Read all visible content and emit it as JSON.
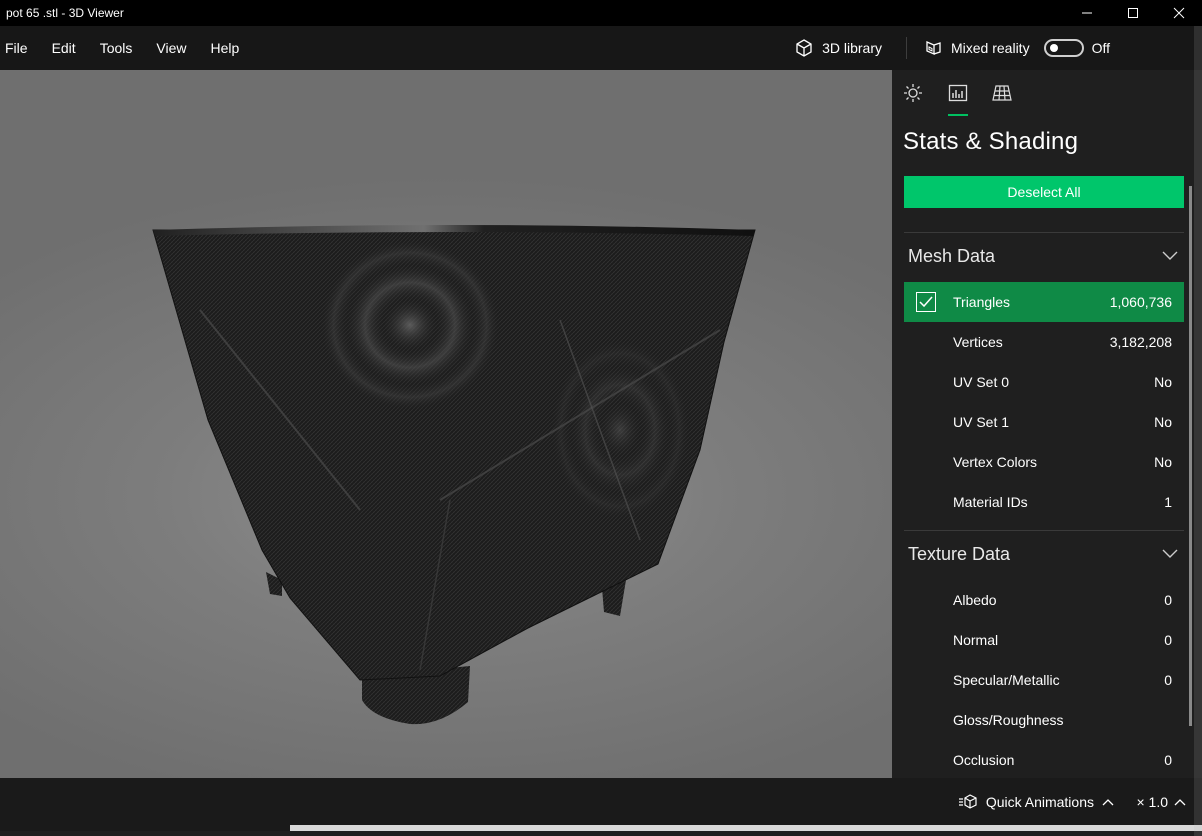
{
  "window": {
    "title": "pot 65 .stl - 3D Viewer",
    "controls": [
      "minimize-icon",
      "maximize-icon",
      "close-icon"
    ]
  },
  "menu": {
    "items": [
      "File",
      "Edit",
      "Tools",
      "View",
      "Help"
    ],
    "library_label": "3D library",
    "mixed_reality_label": "Mixed reality",
    "mixed_reality_state": "Off"
  },
  "panel": {
    "tabs": [
      "lighting-icon",
      "stats-icon",
      "grid-icon"
    ],
    "active_tab": 1,
    "heading": "Stats & Shading",
    "deselect_label": "Deselect All",
    "mesh_section": "Mesh Data",
    "mesh_rows": [
      {
        "name": "Triangles",
        "value": "1,060,736",
        "checked": true
      },
      {
        "name": "Vertices",
        "value": "3,182,208",
        "checked": false
      },
      {
        "name": "UV Set 0",
        "value": "No",
        "checked": false
      },
      {
        "name": "UV Set 1",
        "value": "No",
        "checked": false
      },
      {
        "name": "Vertex Colors",
        "value": "No",
        "checked": false
      },
      {
        "name": "Material IDs",
        "value": "1",
        "checked": false
      }
    ],
    "texture_section": "Texture Data",
    "texture_rows": [
      {
        "name": "Albedo",
        "value": "0"
      },
      {
        "name": "Normal",
        "value": "0"
      },
      {
        "name": "Specular/Metallic",
        "value": "0"
      },
      {
        "name": "Gloss/Roughness",
        "value": ""
      },
      {
        "name": "Occlusion",
        "value": "0"
      }
    ]
  },
  "bottom": {
    "quick_animations_label": "Quick Animations",
    "speed_label": "× 1.0"
  },
  "colors": {
    "accent": "#00c66b",
    "selected_row": "#0f8a46",
    "background": "#1f1f1f"
  }
}
